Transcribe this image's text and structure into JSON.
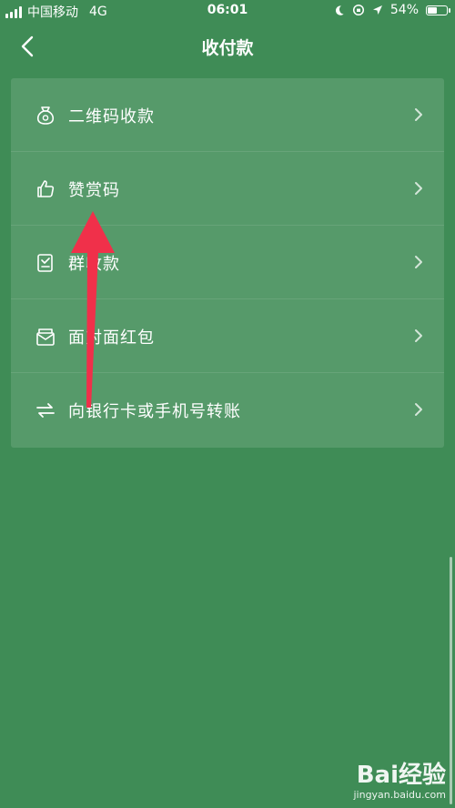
{
  "status_bar": {
    "carrier": "中国移动",
    "network": "4G",
    "time": "06:01",
    "battery": "54%",
    "battery_level": 0.54
  },
  "nav": {
    "title": "收付款",
    "back_icon": "chevron-left-icon"
  },
  "menu": {
    "items": [
      {
        "label": "二维码收款",
        "icon": "money-bag-icon"
      },
      {
        "label": "赞赏码",
        "icon": "thumbs-up-icon"
      },
      {
        "label": "群收款",
        "icon": "group-receipt-icon"
      },
      {
        "label": "面对面红包",
        "icon": "red-packet-icon"
      },
      {
        "label": "向银行卡或手机号转账",
        "icon": "transfer-arrows-icon"
      }
    ]
  },
  "annotation": {
    "color": "#f0304a"
  },
  "watermark": {
    "brand": "Bai经验",
    "url": "jingyan.baidu.com"
  },
  "colors": {
    "background": "#3f8c56",
    "text": "#ffffff"
  }
}
